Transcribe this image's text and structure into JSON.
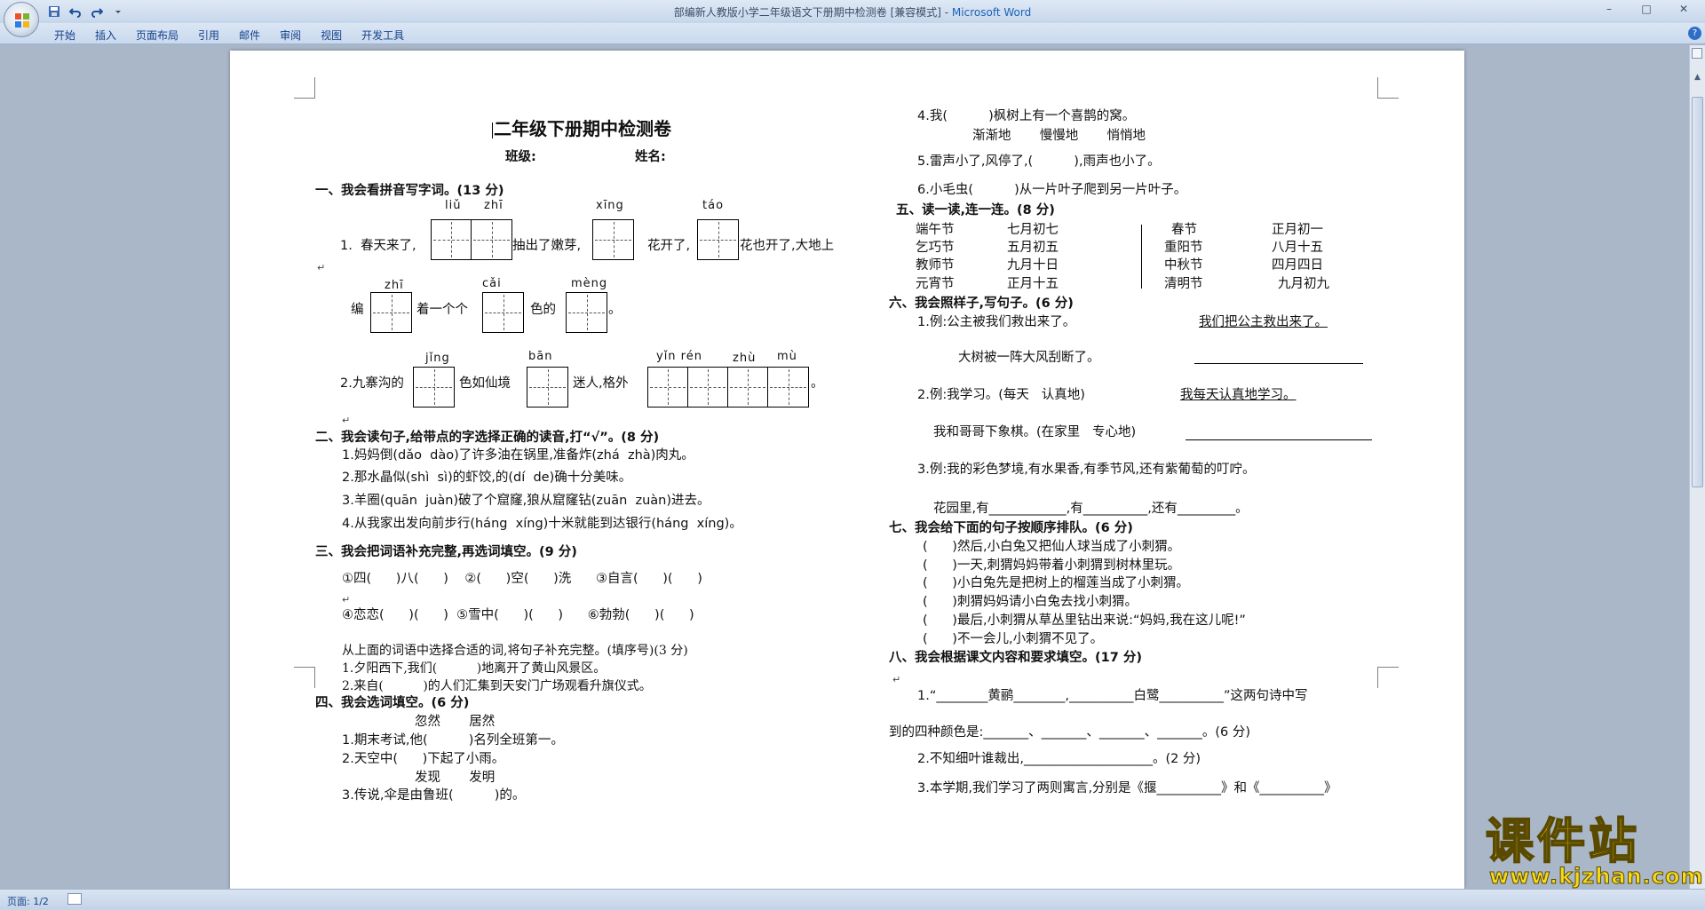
{
  "window": {
    "title_doc": "部编新人教版小学二年级语文下册期中检测卷 [兼容模式] - ",
    "title_app": "Microsoft Word",
    "minimize": "–",
    "maximize": "□",
    "close": "✕"
  },
  "ribbon": {
    "tabs": [
      "开始",
      "插入",
      "页面布局",
      "引用",
      "邮件",
      "审阅",
      "视图",
      "开发工具"
    ],
    "help": "?"
  },
  "statusbar": {
    "page": "页面: 1/2"
  },
  "doc": {
    "title": "二年级下册期中检测卷",
    "class_label": "班级:",
    "name_label": "姓名:",
    "pmark": "↵",
    "s1": {
      "heading": "一、我会看拼音写字词。(13 分)",
      "py_liu": "liǔ",
      "py_zhi1": "zhī",
      "py_xing": "xīng",
      "py_tao": "táo",
      "l1a": "1.  春天来了,",
      "l1b": "抽出了嫩芽,",
      "l1c": "花开了,",
      "l1d": "花也开了,大地上",
      "py_zhi2": "zhī",
      "py_cai": "cǎi",
      "py_meng": "mèng",
      "l2a": "编",
      "l2b": "着一个个",
      "l2c": "色的",
      "l2d": "。",
      "py_jing": "jǐng",
      "py_ban": "bān",
      "py_yinren": "yǐn rén",
      "py_zhu": "zhù",
      "py_mu": "mù",
      "l3a": "2.九寨沟的",
      "l3b": "色如仙境",
      "l3c": "迷人,格外",
      "l3d": "。"
    },
    "s2": {
      "heading": "二、我会读句子,给带点的字选择正确的读音,打“√”。(8 分)",
      "items": [
        "1.妈妈倒(dǎo  dào)了许多油在锅里,准备炸(zhá  zhà)肉丸。",
        "2.那水晶似(shì  sì)的虾饺,的(dí  de)确十分美味。",
        "3.羊圈(quān  juàn)破了个窟窿,狼从窟窿钻(zuān  zuàn)进去。",
        "4.从我家出发向前步行(háng  xíng)十米就能到达银行(háng  xíng)。"
      ]
    },
    "s3": {
      "heading": "三、我会把词语补充完整,再选词填空。(9 分)",
      "row1": "①四(      )八(      )    ②(      )空(      )洗      ③自言(      )(      )",
      "row2": "④恋恋(      )(      )  ⑤雪中(      )(      )      ⑥勃勃(      )(      )",
      "sub": "从上面的词语中选择合适的词,将句子补充完整。(填序号)(3 分)",
      "i1": "1.夕阳西下,我们(          )地离开了黄山风景区。",
      "i2": "2.来自(          )的人们汇集到天安门广场观看升旗仪式。"
    },
    "s4": {
      "heading": "四、我会选词填空。(6 分)",
      "w1": "忽然       居然",
      "i1": "1.期末考试,他(          )名列全班第一。",
      "i2": "2.天空中(      )下起了小雨。",
      "w2": "发现       发明",
      "i3": "3.传说,伞是由鲁班(          )的。",
      "i4": "4.我(          )枫树上有一个喜鹊的窝。",
      "w3": "渐渐地       慢慢地       悄悄地",
      "i5": "5.雷声小了,风停了,(          ),雨声也小了。",
      "i6": "6.小毛虫(          )从一片叶子爬到另一片叶子。"
    },
    "s5": {
      "heading": "五、读一读,连一连。(8 分)",
      "left1": [
        "端午节",
        "乞巧节",
        "教师节",
        "元宵节"
      ],
      "left2": [
        "七月初七",
        "五月初五",
        "九月十日",
        "正月十五"
      ],
      "right1": [
        "春节",
        "重阳节",
        "中秋节",
        "清明节"
      ],
      "right2": [
        "正月初一",
        "八月十五",
        "四月四日",
        "九月初九"
      ]
    },
    "s6": {
      "heading": "六、我会照样子,写句子。(6 分)",
      "e1": "1.例:公主被我们救出来了。",
      "a1": "我们把公主救出来了。",
      "q1": "大树被一阵大风刮断了。",
      "e2": "2.例:我学习。(每天   认真地)",
      "a2": "我每天认真地学习。",
      "q2": "我和哥哥下象棋。(在家里   专心地)",
      "e3": "3.例:我的彩色梦境,有水果香,有季节风,还有紫葡萄的叮咛。",
      "q3": "花园里,有____________,有__________,还有_________。"
    },
    "s7": {
      "heading": "七、我会给下面的句子按顺序排队。(6 分)",
      "items": [
        "(      )然后,小白兔又把仙人球当成了小刺猬。",
        "(      )一天,刺猬妈妈带着小刺猬到树林里玩。",
        "(      )小白兔先是把树上的榴莲当成了小刺猬。",
        "(      )刺猬妈妈请小白兔去找小刺猬。",
        "(      )最后,小刺猬从草丛里钻出来说:“妈妈,我在这儿呢!”",
        "(      )不一会儿,小刺猬不见了。"
      ]
    },
    "s8": {
      "heading": "八、我会根据课文内容和要求填空。(17 分)",
      "i1": "1.“________黄鹂________,__________白鹭__________”这两句诗中写",
      "i1b": "到的四种颜色是:_______、_______、_______、_______。(6 分)",
      "i2": "2.不知细叶谁裁出,____________________。(2 分)",
      "i3": "3.本学期,我们学习了两则寓言,分别是《揠__________》和《__________》"
    }
  },
  "watermark": {
    "main": "课件站",
    "url": "www.kjzhan.com"
  }
}
